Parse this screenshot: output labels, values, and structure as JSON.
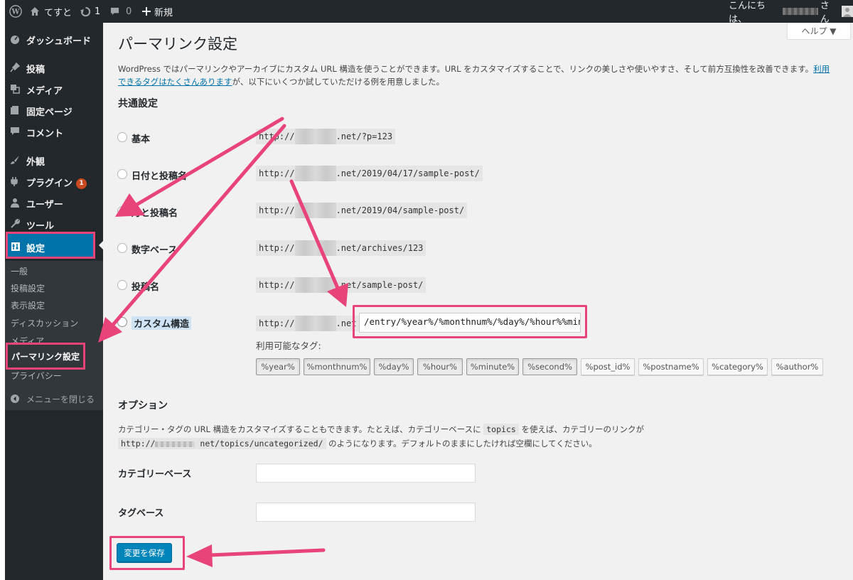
{
  "adminbar": {
    "wp_logo_icon": "wordpress-logo",
    "site_name": "てすと",
    "updates_count": "1",
    "comments_count": "0",
    "new_label": "新規",
    "greeting_prefix": "こんにちは、",
    "greeting_suffix": "さん"
  },
  "sidebar": {
    "items": [
      {
        "label": "ダッシュボード",
        "icon": "dashboard-icon"
      },
      {
        "label": "投稿",
        "icon": "pin-icon"
      },
      {
        "label": "メディア",
        "icon": "media-icon"
      },
      {
        "label": "固定ページ",
        "icon": "page-icon"
      },
      {
        "label": "コメント",
        "icon": "comment-icon"
      },
      {
        "label": "外観",
        "icon": "brush-icon"
      },
      {
        "label": "プラグイン",
        "icon": "plugin-icon",
        "badge": "1"
      },
      {
        "label": "ユーザー",
        "icon": "user-icon"
      },
      {
        "label": "ツール",
        "icon": "wrench-icon"
      },
      {
        "label": "設定",
        "icon": "settings-icon"
      }
    ],
    "submenu": [
      "一般",
      "投稿設定",
      "表示設定",
      "ディスカッション",
      "メディア",
      "パーマリンク設定",
      "プライバシー"
    ],
    "collapse_label": "メニューを閉じる"
  },
  "main": {
    "help_label": "ヘルプ ▼",
    "title": "パーマリンク設定",
    "intro_text": "WordPress ではパーマリンクやアーカイブにカスタム URL 構造を使うことができます。URL をカスタマイズすることで、リンクの美しさや使いやすさ、そして前方互換性を改善できます。",
    "intro_link": "利用できるタグはたくさんあります",
    "intro_tail": "が、以下にいくつか試していただける例を用意しました。",
    "common_heading": "共通設定",
    "options": [
      {
        "label": "基本",
        "url_prefix": "http://",
        "url_suffix": ".net/?p=123"
      },
      {
        "label": "日付と投稿名",
        "url_prefix": "http://",
        "url_suffix": ".net/2019/04/17/sample-post/"
      },
      {
        "label": "月と投稿名",
        "url_prefix": "http://",
        "url_suffix": ".net/2019/04/sample-post/"
      },
      {
        "label": "数字ベース",
        "url_prefix": "http://",
        "url_suffix": ".net/archives/123"
      },
      {
        "label": "投稿名",
        "url_prefix": "http://",
        "url_suffix": ".net/sample-post/"
      },
      {
        "label": "カスタム構造",
        "url_prefix": "http://",
        "url_suffix": ".net"
      }
    ],
    "custom_value": "/entry/%year%/%monthnum%/%day%/%hour%%minute%/",
    "available_tags_label": "利用可能なタグ:",
    "tags": [
      "%year%",
      "%monthnum%",
      "%day%",
      "%hour%",
      "%minute%",
      "%second%",
      "%post_id%",
      "%postname%",
      "%category%",
      "%author%"
    ],
    "options_heading": "オプション",
    "options_desc_1": "カテゴリー・タグの URL 構造をカスタマイズすることもできます。たとえば、カテゴリーベースに",
    "options_desc_code": "topics",
    "options_desc_2": "を使えば、カテゴリーのリンクが",
    "options_desc_url_1": "http://",
    "options_desc_url_2": "net/topics/uncategorized/",
    "options_desc_3": "のようになります。デフォルトのままにしたければ空欄にしてください。",
    "category_base_label": "カテゴリーベース",
    "category_base_value": "",
    "tag_base_label": "タグベース",
    "tag_base_value": "",
    "save_label": "変更を保存"
  },
  "colors": {
    "adminbar_bg": "#23282d",
    "sidebar_bg": "#23282d",
    "submenu_bg": "#32373c",
    "active_blue": "#0073aa",
    "button_blue": "#0085ba",
    "highlight_pink": "#e8447a",
    "main_bg": "#f1f1f1"
  }
}
